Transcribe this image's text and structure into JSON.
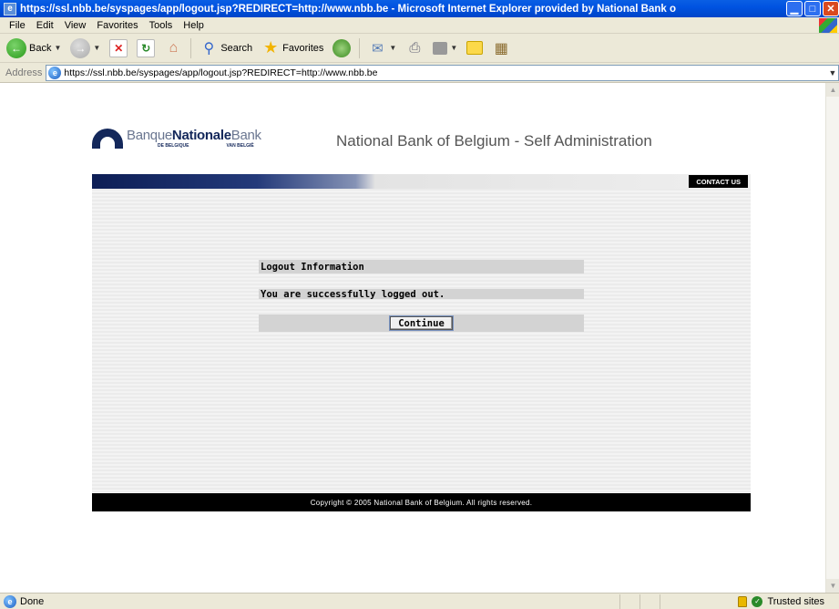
{
  "window": {
    "title": "https://ssl.nbb.be/syspages/app/logout.jsp?REDIRECT=http://www.nbb.be - Microsoft Internet Explorer provided by National Bank o"
  },
  "menu": {
    "items": [
      "File",
      "Edit",
      "View",
      "Favorites",
      "Tools",
      "Help"
    ]
  },
  "toolbar": {
    "back_label": "Back",
    "search_label": "Search",
    "favorites_label": "Favorites"
  },
  "address": {
    "label": "Address",
    "url": "https://ssl.nbb.be/syspages/app/logout.jsp?REDIRECT=http://www.nbb.be"
  },
  "page": {
    "logo": {
      "banque": "Banque",
      "nationale": "Nationale",
      "bank": "Bank",
      "sub_left": "DE BELGIQUE",
      "sub_right": "VAN BELGIË"
    },
    "site_title": "National Bank of Belgium - Self Administration",
    "contact_label": "CONTACT US",
    "logout": {
      "heading": "Logout Information",
      "message": "You are successfully logged out.",
      "continue_label": "Continue"
    },
    "footer": "Copyright © 2005 National Bank of Belgium. All rights reserved."
  },
  "status": {
    "text": "Done",
    "zone": "Trusted sites"
  }
}
